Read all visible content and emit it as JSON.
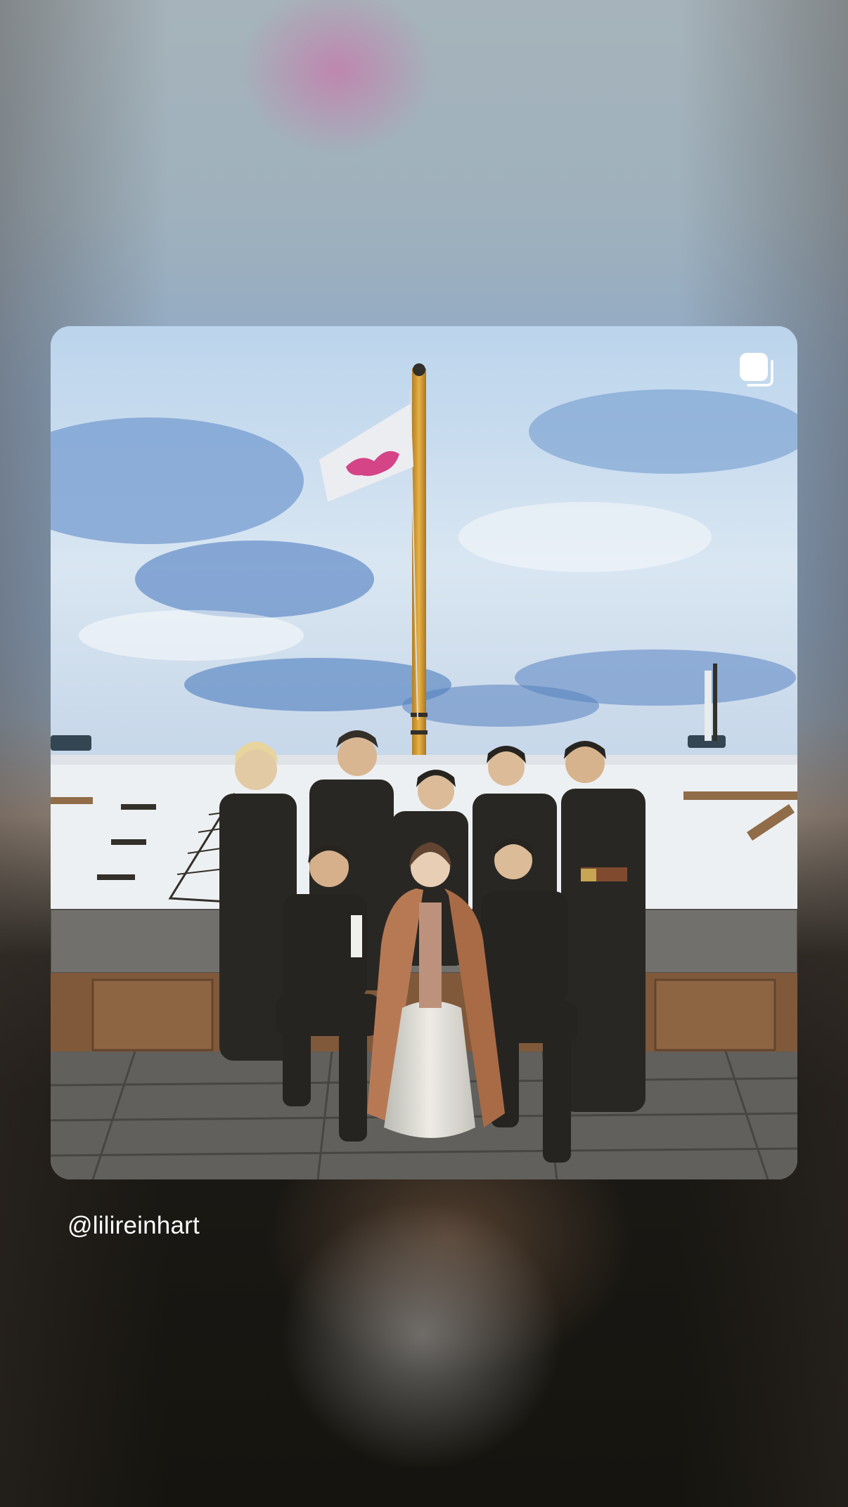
{
  "post": {
    "username": "@lilireinhart",
    "media_type_icon": "multiple-images-icon"
  }
}
